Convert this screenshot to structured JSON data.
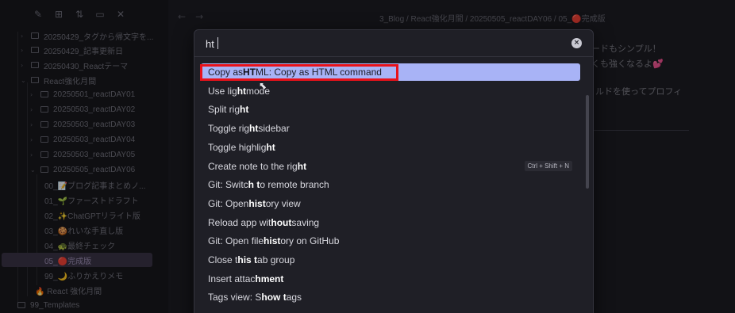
{
  "sidebar": {
    "items": [
      {
        "label": "20250429_タグから帰文字を..."
      },
      {
        "label": "20250429_記事更新日"
      },
      {
        "label": "20250430_Reactテーマ"
      },
      {
        "label": "React強化月間"
      },
      {
        "label": "20250501_reactDAY01"
      },
      {
        "label": "20250503_reactDAY02"
      },
      {
        "label": "20250503_reactDAY03"
      },
      {
        "label": "20250503_reactDAY04"
      },
      {
        "label": "20250503_reactDAY05"
      },
      {
        "label": "20250505_reactDAY06"
      },
      {
        "label": "00_📝ブログ記事まとめノ..."
      },
      {
        "label": "01_🌱ファーストドラフト"
      },
      {
        "label": "02_✨ChatGPTリライト版"
      },
      {
        "label": "03_🍪れいな手直し版"
      },
      {
        "label": "04_🐢最終チェック"
      },
      {
        "label": "05_🔴完成版"
      },
      {
        "label": "99_🌙ふりかえりメモ"
      },
      {
        "label": "🔥 React 強化月間"
      },
      {
        "label": "99_Templates"
      }
    ]
  },
  "editor": {
    "breadcrumb": "3_Blog / React強化月間 / 20250505_reactDAY06 / 05_🔴完成版",
    "bg_line1": "ードもシンプル！",
    "bg_line2": "くも強くなるよ💕",
    "bg_line3": "ルドを使ってプロフィ"
  },
  "palette": {
    "query": "ht",
    "results": [
      {
        "pre": "Copy as ",
        "hl": "HT",
        "post": "ML: Copy as HTML command",
        "hotkey": ""
      },
      {
        "pre": "Use lig",
        "hl": "ht",
        "post": " mode",
        "hotkey": ""
      },
      {
        "pre": "Split rig",
        "hl": "ht",
        "post": "",
        "hotkey": ""
      },
      {
        "pre": "Toggle rig",
        "hl": "ht",
        "post": " sidebar",
        "hotkey": ""
      },
      {
        "pre": "Toggle highlig",
        "hl": "ht",
        "post": "",
        "hotkey": ""
      },
      {
        "pre": "Create note to the rig",
        "hl": "ht",
        "post": "",
        "hotkey": "Ctrl + Shift + N"
      },
      {
        "pre": "Git: Switc",
        "hl": "h t",
        "post": "o remote branch",
        "hotkey": ""
      },
      {
        "pre": "Git: Open ",
        "hl": "hist",
        "post": "ory view",
        "hotkey": ""
      },
      {
        "pre": "Reload app wit",
        "hl": "hout",
        "post": " saving",
        "hotkey": ""
      },
      {
        "pre": "Git: Open file ",
        "hl": "hist",
        "post": "ory on GitHub",
        "hotkey": ""
      },
      {
        "pre": "Close t",
        "hl": "his t",
        "post": "ab group",
        "hotkey": ""
      },
      {
        "pre": "Insert attac",
        "hl": "hment",
        "post": "",
        "hotkey": ""
      },
      {
        "pre": "Tags view: S",
        "hl": "how t",
        "post": "ags",
        "hotkey": ""
      }
    ]
  },
  "colors": {
    "selected_bg": "#a8b3f6",
    "highlight_box": "#e8121a",
    "background": "#1b1b21"
  }
}
